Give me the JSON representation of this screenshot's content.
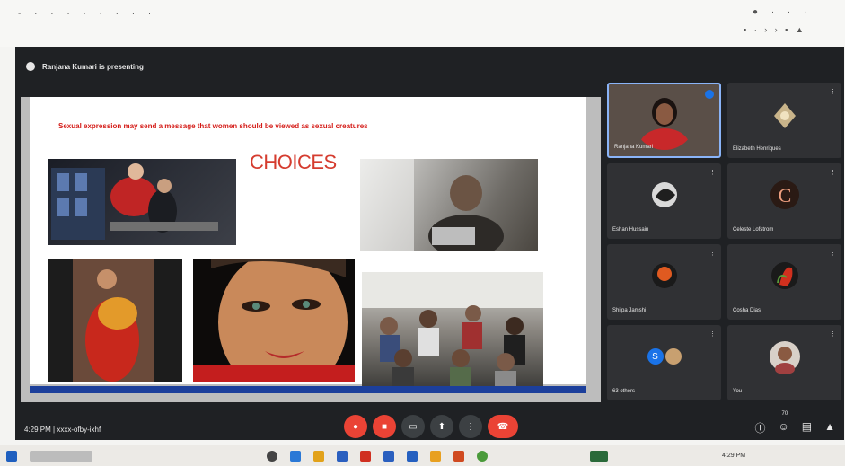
{
  "top_bar": {
    "left_text": "- · · ·  · ·  ·   ·  ·",
    "right_text": "● ·  ·  ·",
    "right_status": "▪ · › › ▪ ▲"
  },
  "meet": {
    "presenter_text": "Ranjana Kumari is presenting",
    "slide": {
      "headline": "Sexual expression may send a message that women should be viewed as sexual creatures",
      "title": "CHOICES"
    },
    "participants": [
      {
        "name": "Ranjana Kumari"
      },
      {
        "name": "Elizabeth Henriques"
      },
      {
        "name": "Eshan Hussain"
      },
      {
        "name": "Celeste Lofstrom"
      },
      {
        "name": "Shilpa Jamshi"
      },
      {
        "name": "Cosha Dias"
      },
      {
        "name": "63 others",
        "initial": "S"
      },
      {
        "name": "You"
      }
    ],
    "meeting_time": "4:29 PM  |  xxxx-ofby-ixhf",
    "people_badge": "70"
  },
  "taskbar": {
    "clock": "4:29 PM"
  },
  "colors": {
    "headline_red": "#d41a16",
    "choices_red": "#d53c2f",
    "end_call": "#ea4335",
    "active_tile": "#8ab4f8",
    "slide_blue": "#1c3f9b"
  }
}
